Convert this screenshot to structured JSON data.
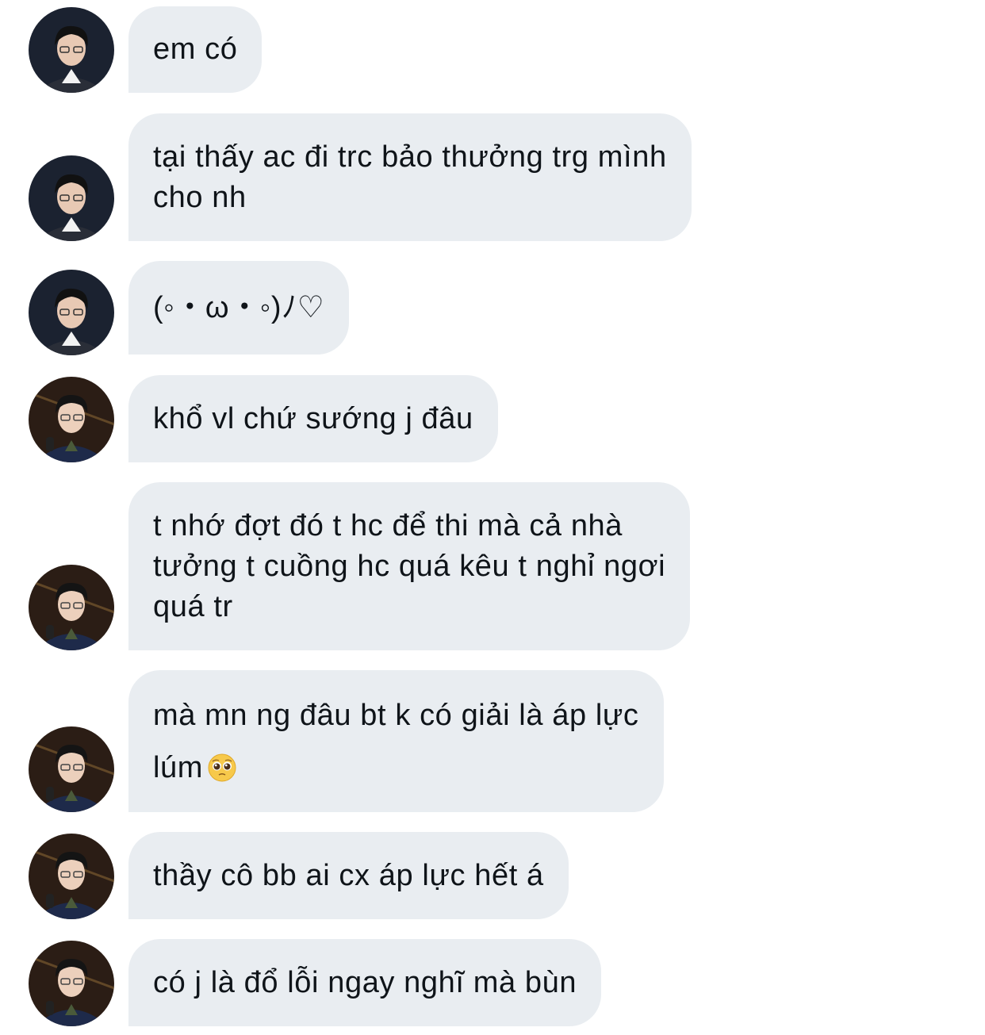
{
  "messages": [
    {
      "avatar": "avatar-a",
      "lines": [
        "em có"
      ]
    },
    {
      "avatar": "avatar-a",
      "lines": [
        "tại thấy ac đi trc bảo thưởng trg mình",
        "cho nh"
      ]
    },
    {
      "avatar": "avatar-a",
      "lines": [
        "(◦・ω・◦)ﾉ♡"
      ]
    },
    {
      "avatar": "avatar-b",
      "lines": [
        "khổ vl chứ sướng j đâu"
      ]
    },
    {
      "avatar": "avatar-b",
      "lines": [
        "t nhớ đợt đó t hc để thi mà cả nhà",
        "tưởng t cuồng hc quá kêu t nghỉ ngơi",
        "quá tr"
      ]
    },
    {
      "avatar": "avatar-b",
      "lines": [
        "mà mn ng đâu bt k có giải là áp lực",
        "lúm"
      ],
      "emoji": "pleading-face-icon"
    },
    {
      "avatar": "avatar-b",
      "lines": [
        "thầy cô bb ai cx áp lực hết á"
      ]
    },
    {
      "avatar": "avatar-b",
      "lines": [
        "có j là đổ lỗi ngay nghĩ mà bùn"
      ]
    }
  ],
  "colors": {
    "bubble_bg": "#e9edf1",
    "text": "#0f1419",
    "background": "#ffffff"
  }
}
